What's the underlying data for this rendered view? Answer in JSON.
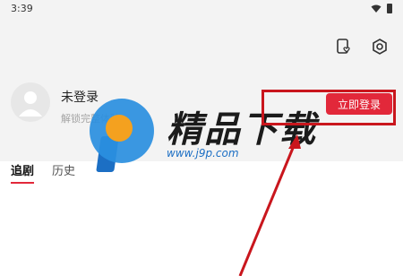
{
  "status_bar": {
    "time": "3:39"
  },
  "profile": {
    "name": "未登录",
    "subtitle": "解锁完整体验",
    "login_button": "立即登录"
  },
  "tabs": [
    {
      "label": "追剧",
      "active": true
    },
    {
      "label": "历史",
      "active": false
    }
  ],
  "watermark": {
    "title": "精品下载",
    "url": "www.j9p.com"
  },
  "colors": {
    "accent": "#e2283a",
    "annotation": "#c9161d",
    "background_top": "#f3f3f3",
    "watermark_blue": "#2a8fe0",
    "watermark_orange": "#f4a11f"
  },
  "icons": [
    "wifi-icon",
    "battery-icon",
    "heart-note-icon",
    "settings-gear-icon",
    "avatar-placeholder-icon"
  ]
}
